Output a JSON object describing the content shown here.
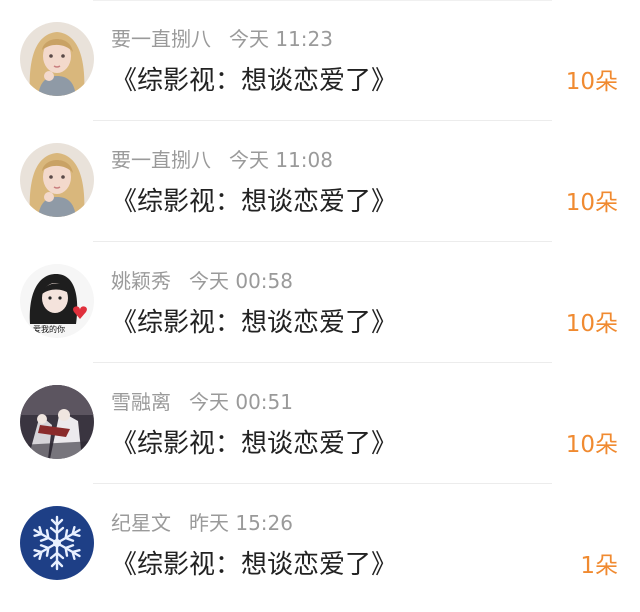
{
  "gifts": [
    {
      "user": "要一直捌八",
      "time": "今天 11:23",
      "title": "《综影视：想谈恋爱了》",
      "count": "10朵",
      "avatar_icon": "blonde-girl-avatar-icon"
    },
    {
      "user": "要一直捌八",
      "time": "今天 11:08",
      "title": "《综影视：想谈恋爱了》",
      "count": "10朵",
      "avatar_icon": "blonde-girl-avatar-icon"
    },
    {
      "user": "姚颖秀",
      "time": "今天 00:58",
      "title": "《综影视：想谈恋爱了》",
      "count": "10朵",
      "avatar_icon": "dark-hair-girl-heart-avatar-icon"
    },
    {
      "user": "雪融离",
      "time": "今天 00:51",
      "title": "《综影视：想谈恋爱了》",
      "count": "10朵",
      "avatar_icon": "anime-figures-avatar-icon"
    },
    {
      "user": "纪星文",
      "time": "昨天 15:26",
      "title": "《综影视：想谈恋爱了》",
      "count": "1朵",
      "avatar_icon": "snowflake-avatar-icon"
    }
  ],
  "colors": {
    "count": "#f08a30",
    "name": "#9a9a9a",
    "title": "#222222"
  }
}
